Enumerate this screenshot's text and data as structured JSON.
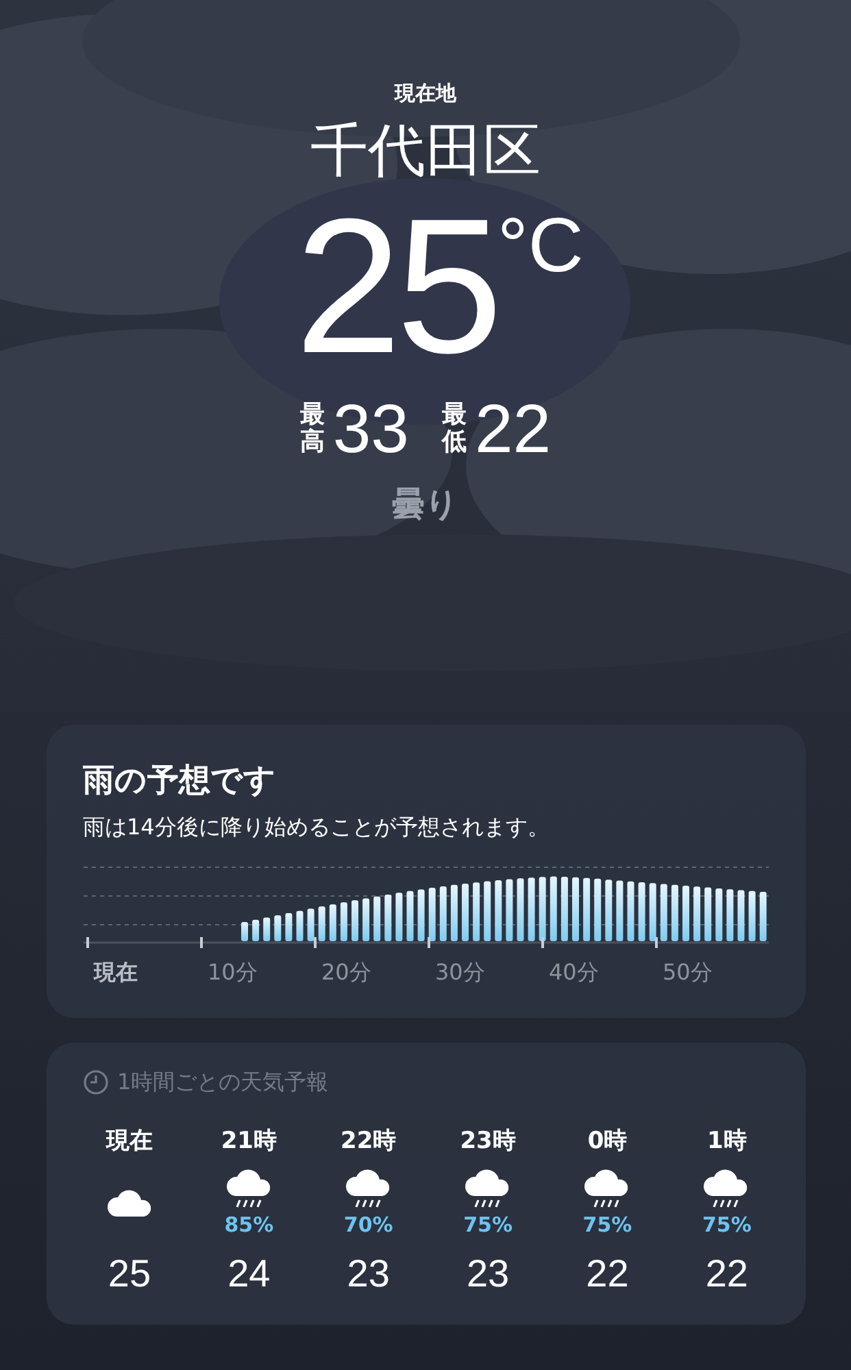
{
  "location_label": "現在地",
  "city": "千代田区",
  "temperature": "25",
  "unit": "°C",
  "high": {
    "label": "最高",
    "value": "33"
  },
  "low": {
    "label": "最低",
    "value": "22"
  },
  "condition": "曇り",
  "rain_card": {
    "title": "雨の予想です",
    "message": "雨は14分後に降り始めることが予想されます。",
    "axis_labels": [
      "現在",
      "10分",
      "20分",
      "30分",
      "40分",
      "50分"
    ]
  },
  "hourly_card": {
    "title": "1時間ごとの天気予報",
    "hours": [
      {
        "time": "現在",
        "kind": "cloud",
        "temp": "25"
      },
      {
        "time": "21時",
        "kind": "rain",
        "chance": "85%",
        "temp": "24"
      },
      {
        "time": "22時",
        "kind": "rain",
        "chance": "70%",
        "temp": "23"
      },
      {
        "time": "23時",
        "kind": "rain",
        "chance": "75%",
        "temp": "23"
      },
      {
        "time": "0時",
        "kind": "rain",
        "chance": "75%",
        "temp": "22"
      },
      {
        "time": "1時",
        "kind": "rain",
        "chance": "75%",
        "temp": "22"
      }
    ]
  }
}
